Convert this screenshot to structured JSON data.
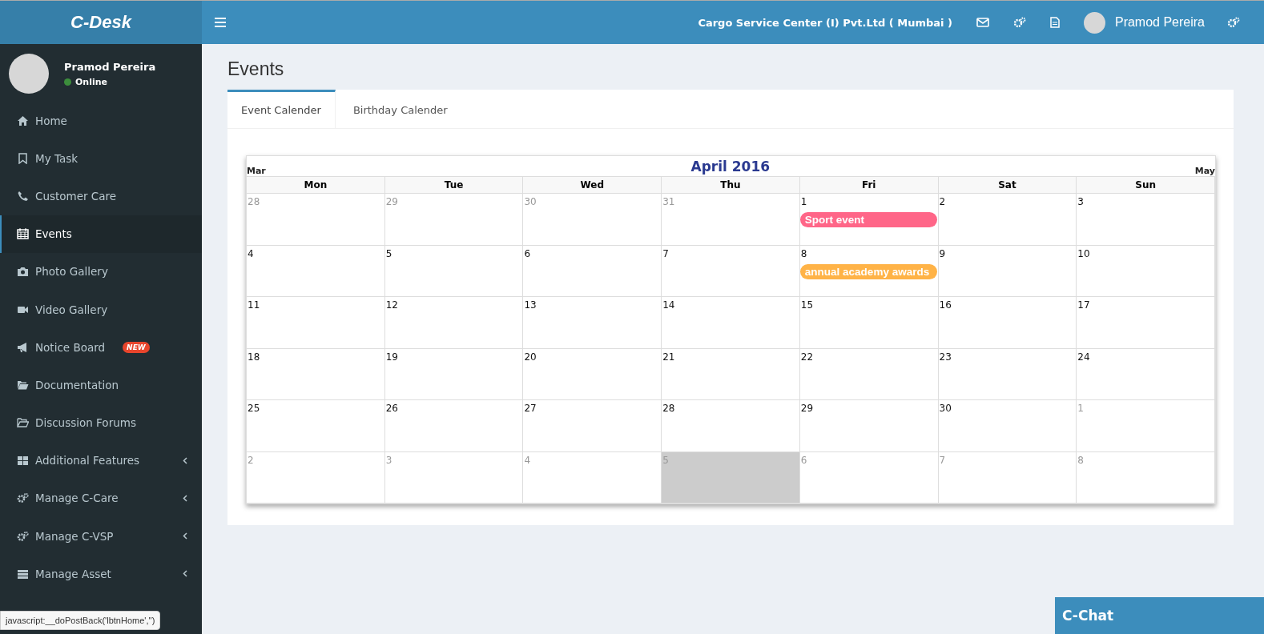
{
  "header": {
    "brand": "C-Desk",
    "company": "Cargo Service Center (I) Pvt.Ltd ( Mumbai )",
    "user": "Pramod Pereira"
  },
  "profile": {
    "name": "Pramod Pereira",
    "status": "Online"
  },
  "sidebar": {
    "items": [
      {
        "label": "Home",
        "kind": "home",
        "selected": false,
        "expandable": false
      },
      {
        "label": "My Task",
        "kind": "bookmark",
        "selected": false,
        "expandable": false
      },
      {
        "label": "Customer Care",
        "kind": "phone",
        "selected": false,
        "expandable": false
      },
      {
        "label": "Events",
        "kind": "calendar",
        "selected": true,
        "expandable": false
      },
      {
        "label": "Photo Gallery",
        "kind": "camera",
        "selected": false,
        "expandable": false
      },
      {
        "label": "Video Gallery",
        "kind": "video",
        "selected": false,
        "expandable": false
      },
      {
        "label": "Notice Board",
        "kind": "bullhorn",
        "selected": false,
        "expandable": false,
        "badge": "NEW"
      },
      {
        "label": "Documentation",
        "kind": "folder",
        "selected": false,
        "expandable": false
      },
      {
        "label": "Discussion Forums",
        "kind": "folder-outline",
        "selected": false,
        "expandable": false
      },
      {
        "label": "Additional Features",
        "kind": "grid",
        "selected": false,
        "expandable": true
      },
      {
        "label": "Manage C-Care",
        "kind": "gears",
        "selected": false,
        "expandable": true
      },
      {
        "label": "Manage C-VSP",
        "kind": "gears",
        "selected": false,
        "expandable": true
      },
      {
        "label": "Manage Asset",
        "kind": "server",
        "selected": false,
        "expandable": true
      }
    ]
  },
  "page_title": "Events",
  "tabs": [
    {
      "label": "Event Calender",
      "selected": true
    },
    {
      "label": "Birthday Calender",
      "selected": false
    }
  ],
  "calendar": {
    "title": "April 2016",
    "prev": "Mar",
    "next": "May",
    "weekdays": [
      "Mon",
      "Tue",
      "Wed",
      "Thu",
      "Fri",
      "Sat",
      "Sun"
    ],
    "weeks": [
      [
        {
          "day": "28",
          "other_month": true,
          "highlighted": false
        },
        {
          "day": "29",
          "other_month": true,
          "highlighted": false
        },
        {
          "day": "30",
          "other_month": true,
          "highlighted": false
        },
        {
          "day": "31",
          "other_month": true,
          "highlighted": false
        },
        {
          "day": "1",
          "other_month": false,
          "highlighted": false,
          "events": [
            {
              "label": "Sport event",
              "color": "#ff6688"
            }
          ]
        },
        {
          "day": "2",
          "other_month": false,
          "highlighted": false
        },
        {
          "day": "3",
          "other_month": false,
          "highlighted": false
        }
      ],
      [
        {
          "day": "4",
          "other_month": false,
          "highlighted": false
        },
        {
          "day": "5",
          "other_month": false,
          "highlighted": false
        },
        {
          "day": "6",
          "other_month": false,
          "highlighted": false
        },
        {
          "day": "7",
          "other_month": false,
          "highlighted": false
        },
        {
          "day": "8",
          "other_month": false,
          "highlighted": false,
          "events": [
            {
              "label": "annual academy awards",
              "color": "#ffb347"
            }
          ]
        },
        {
          "day": "9",
          "other_month": false,
          "highlighted": false
        },
        {
          "day": "10",
          "other_month": false,
          "highlighted": false
        }
      ],
      [
        {
          "day": "11",
          "other_month": false,
          "highlighted": false
        },
        {
          "day": "12",
          "other_month": false,
          "highlighted": false
        },
        {
          "day": "13",
          "other_month": false,
          "highlighted": false
        },
        {
          "day": "14",
          "other_month": false,
          "highlighted": false
        },
        {
          "day": "15",
          "other_month": false,
          "highlighted": false
        },
        {
          "day": "16",
          "other_month": false,
          "highlighted": false
        },
        {
          "day": "17",
          "other_month": false,
          "highlighted": false
        }
      ],
      [
        {
          "day": "18",
          "other_month": false,
          "highlighted": false
        },
        {
          "day": "19",
          "other_month": false,
          "highlighted": false
        },
        {
          "day": "20",
          "other_month": false,
          "highlighted": false
        },
        {
          "day": "21",
          "other_month": false,
          "highlighted": false
        },
        {
          "day": "22",
          "other_month": false,
          "highlighted": false
        },
        {
          "day": "23",
          "other_month": false,
          "highlighted": false
        },
        {
          "day": "24",
          "other_month": false,
          "highlighted": false
        }
      ],
      [
        {
          "day": "25",
          "other_month": false,
          "highlighted": false
        },
        {
          "day": "26",
          "other_month": false,
          "highlighted": false
        },
        {
          "day": "27",
          "other_month": false,
          "highlighted": false
        },
        {
          "day": "28",
          "other_month": false,
          "highlighted": false
        },
        {
          "day": "29",
          "other_month": false,
          "highlighted": false
        },
        {
          "day": "30",
          "other_month": false,
          "highlighted": false
        },
        {
          "day": "1",
          "other_month": true,
          "highlighted": false
        }
      ],
      [
        {
          "day": "2",
          "other_month": true,
          "highlighted": false
        },
        {
          "day": "3",
          "other_month": true,
          "highlighted": false
        },
        {
          "day": "4",
          "other_month": true,
          "highlighted": false
        },
        {
          "day": "5",
          "other_month": true,
          "highlighted": true
        },
        {
          "day": "6",
          "other_month": true,
          "highlighted": false
        },
        {
          "day": "7",
          "other_month": true,
          "highlighted": false
        },
        {
          "day": "8",
          "other_month": true,
          "highlighted": false
        }
      ]
    ]
  },
  "chat": {
    "label": "C-Chat"
  },
  "status_link": "javascript:__doPostBack('lbtnHome','')"
}
